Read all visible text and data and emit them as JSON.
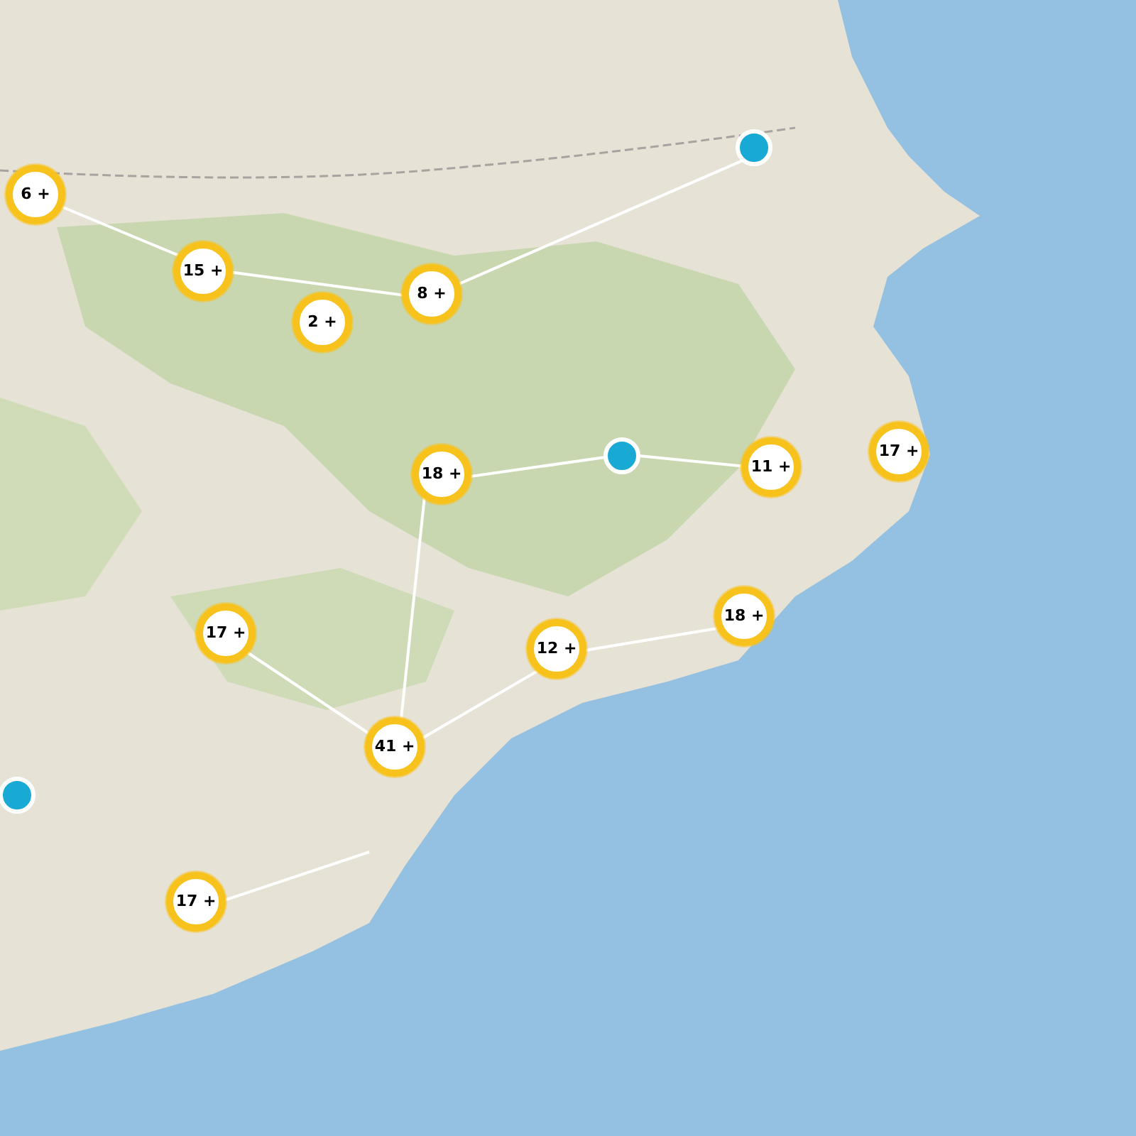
{
  "markers": [
    {
      "kind": "point"
    },
    {
      "kind": "cluster",
      "count": "6 +"
    },
    {
      "kind": "cluster",
      "count": "15 +"
    },
    {
      "kind": "cluster",
      "count": "8 +"
    },
    {
      "kind": "cluster",
      "count": "2 +"
    },
    {
      "kind": "cluster",
      "count": "17 +"
    },
    {
      "kind": "point"
    },
    {
      "kind": "cluster",
      "count": "11 +"
    },
    {
      "kind": "cluster",
      "count": "18 +"
    },
    {
      "kind": "cluster",
      "count": "18 +"
    },
    {
      "kind": "cluster",
      "count": "17 +"
    },
    {
      "kind": "cluster",
      "count": "12 +"
    },
    {
      "kind": "cluster",
      "count": "41 +"
    },
    {
      "kind": "point"
    },
    {
      "kind": "cluster",
      "count": "17 +"
    }
  ]
}
